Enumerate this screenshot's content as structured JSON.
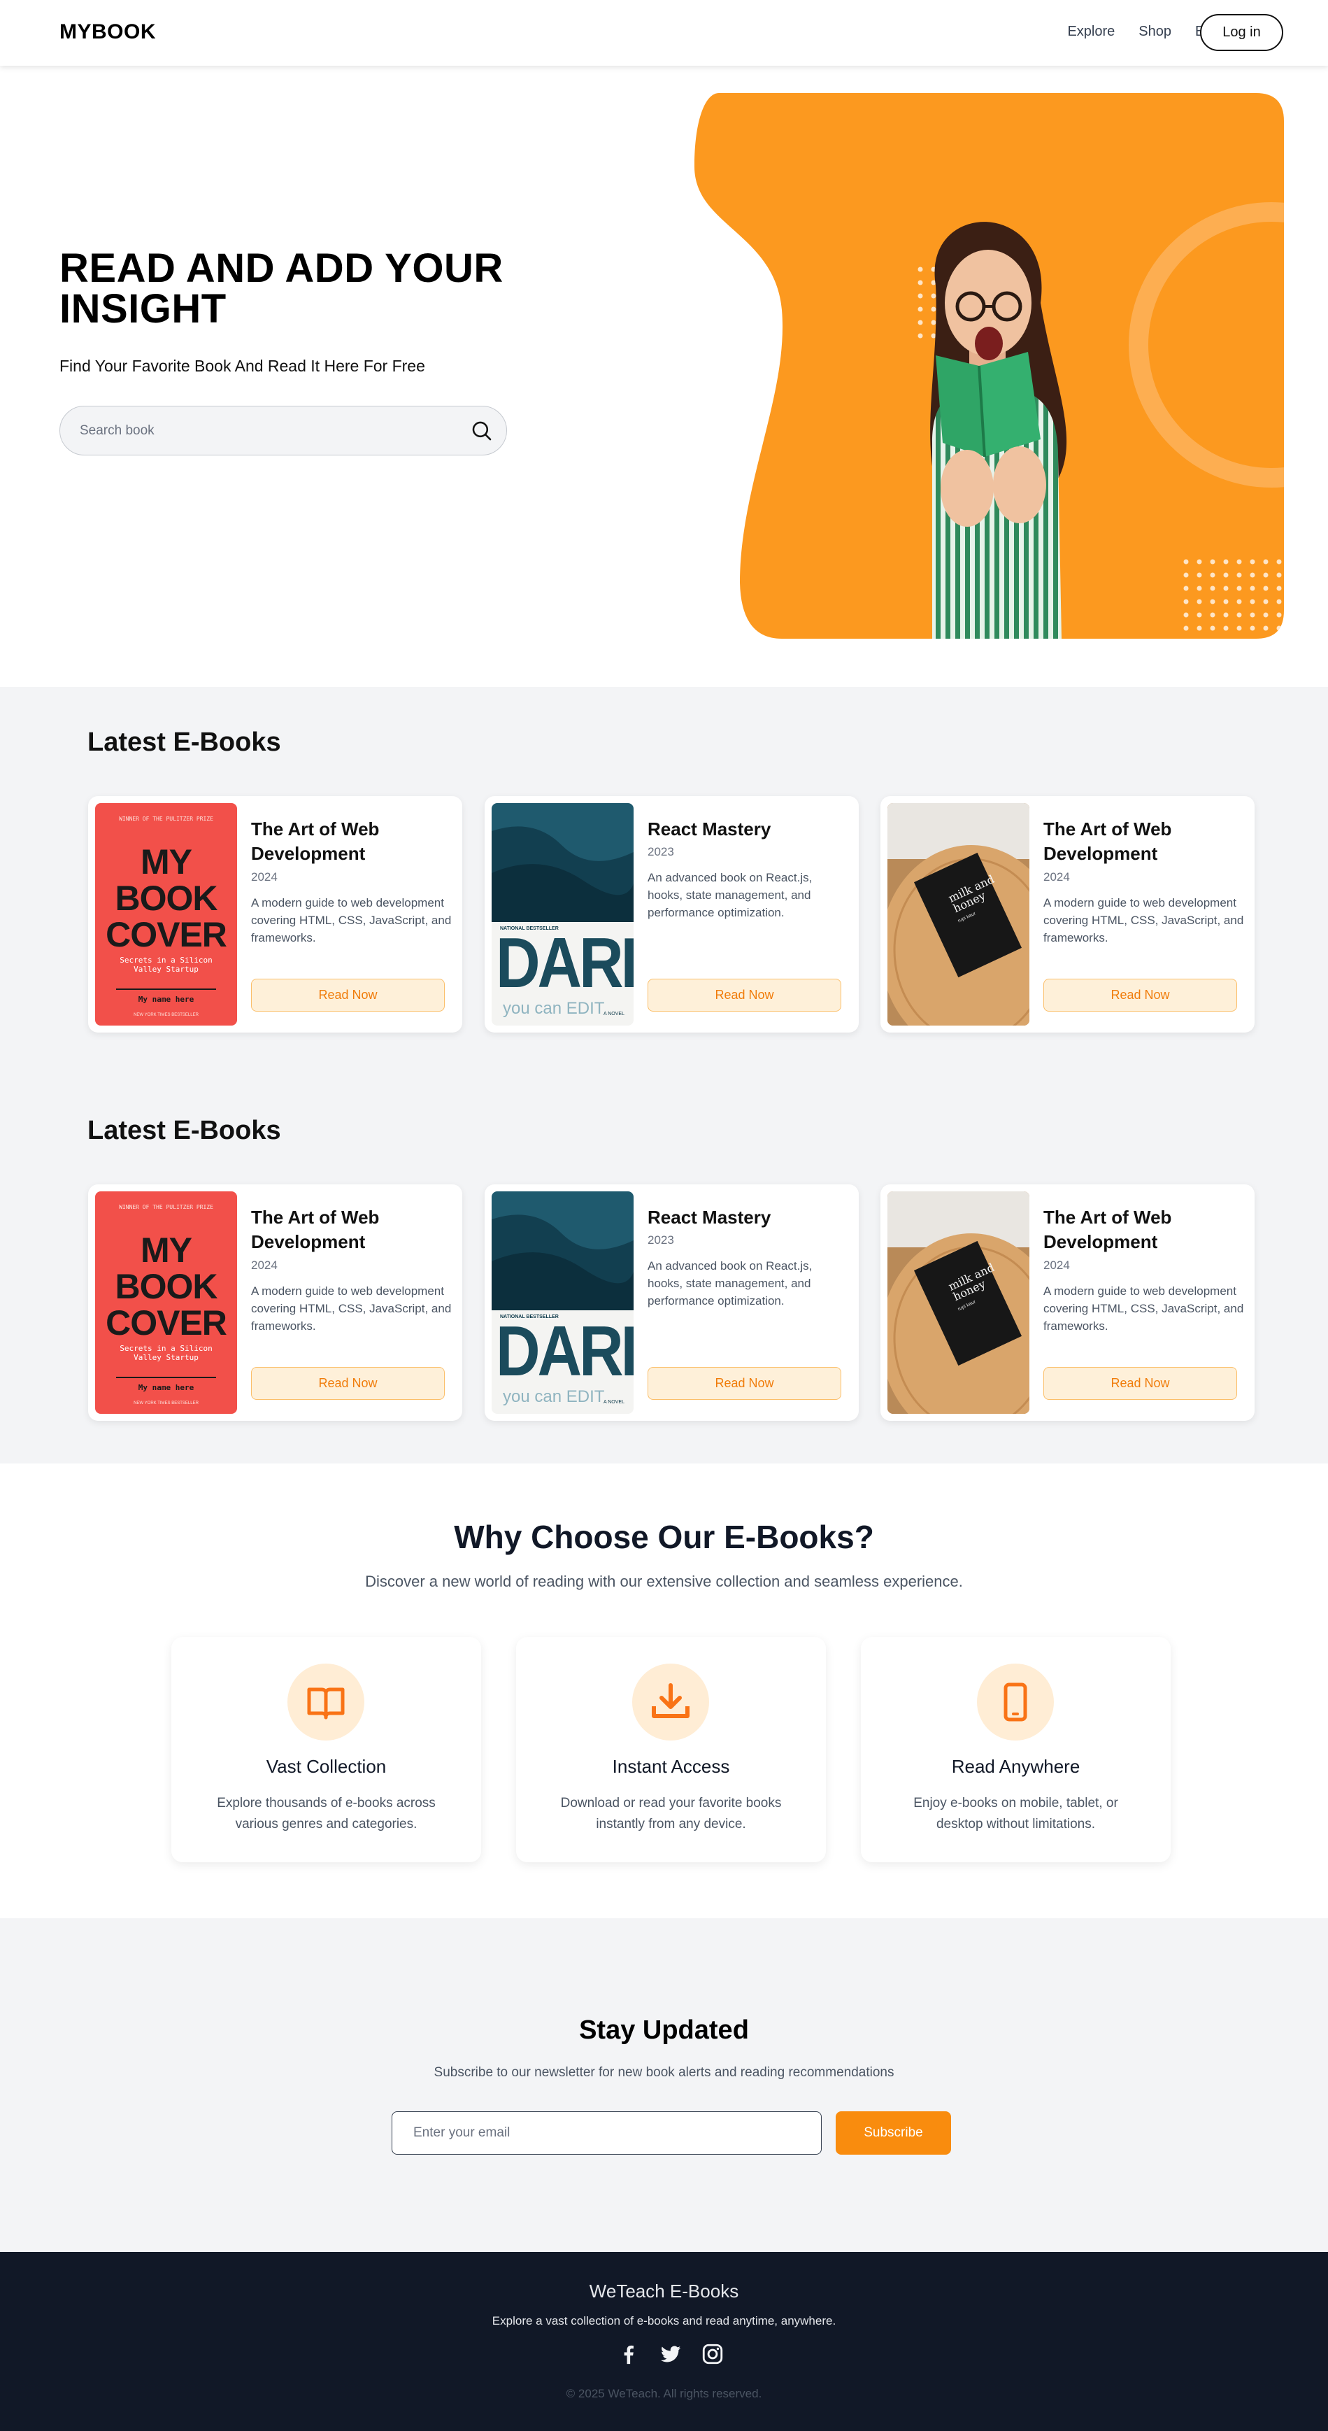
{
  "nav": {
    "logo": "MYBOOK",
    "links": [
      "Explore",
      "Shop",
      "Blog"
    ],
    "login_label": "Log in"
  },
  "hero": {
    "title": "READ AND ADD YOUR INSIGHT",
    "subtitle": "Find Your Favorite Book And Read It Here For Free",
    "search_placeholder": "Search book"
  },
  "sections": [
    {
      "title": "Latest E-Books",
      "books": [
        {
          "title": "The Art of Web Development",
          "year": "2024",
          "description": "A modern guide to web development covering HTML, CSS, JavaScript, and frameworks.",
          "button": "Read Now",
          "cover": {
            "top": "WINNER OF THE PULITZER PRIZE",
            "big": [
              "MY",
              "BOOK",
              "COVER"
            ],
            "tag": "Secrets in a Silicon Valley Startup",
            "name": "My name here",
            "foot": "NEW YORK TIMES BESTSELLER"
          }
        },
        {
          "title": "React Mastery",
          "year": "2023",
          "description": "An advanced book on React.js, hooks, state management, and performance optimization.",
          "button": "Read Now",
          "cover": {
            "small": "NATIONAL BESTSELLER",
            "big": "DARK",
            "sub": "you can EDIT",
            "novel": "A NOVEL"
          }
        },
        {
          "title": "The Art of Web Development",
          "year": "2024",
          "description": "A modern guide to web development covering HTML, CSS, JavaScript, and frameworks.",
          "button": "Read Now",
          "cover": {
            "book_title": "milk and honey",
            "author": "rupi kaur"
          }
        }
      ]
    },
    {
      "title": "Latest E-Books",
      "books": [
        {
          "title": "The Art of Web Development",
          "year": "2024",
          "description": "A modern guide to web development covering HTML, CSS, JavaScript, and frameworks.",
          "button": "Read Now",
          "cover": {
            "top": "WINNER OF THE PULITZER PRIZE",
            "big": [
              "MY",
              "BOOK",
              "COVER"
            ],
            "tag": "Secrets in a Silicon Valley Startup",
            "name": "My name here",
            "foot": "NEW YORK TIMES BESTSELLER"
          }
        },
        {
          "title": "React Mastery",
          "year": "2023",
          "description": "An advanced book on React.js, hooks, state management, and performance optimization.",
          "button": "Read Now",
          "cover": {
            "small": "NATIONAL BESTSELLER",
            "big": "DARK",
            "sub": "you can EDIT",
            "novel": "A NOVEL"
          }
        },
        {
          "title": "The Art of Web Development",
          "year": "2024",
          "description": "A modern guide to web development covering HTML, CSS, JavaScript, and frameworks.",
          "button": "Read Now",
          "cover": {
            "book_title": "milk and honey",
            "author": "rupi kaur"
          }
        }
      ]
    }
  ],
  "why": {
    "title": "Why Choose Our E-Books?",
    "subtitle": "Discover a new world of reading with our extensive collection and seamless experience.",
    "features": [
      {
        "icon": "open-book-icon",
        "title": "Vast Collection",
        "description": "Explore thousands of e-books across various genres and categories."
      },
      {
        "icon": "download-icon",
        "title": "Instant Access",
        "description": "Download or read your favorite books instantly from any device."
      },
      {
        "icon": "mobile-phone-icon",
        "title": "Read Anywhere",
        "description": "Enjoy e-books on mobile, tablet, or desktop without limitations."
      }
    ]
  },
  "newsletter": {
    "title": "Stay Updated",
    "subtitle": "Subscribe to our newsletter for new book alerts and reading recommendations",
    "email_placeholder": "Enter your email",
    "button": "Subscribe"
  },
  "footer": {
    "title": "WeTeach E-Books",
    "subtitle": "Explore a vast collection of e-books and read anytime, anywhere.",
    "social": [
      "facebook-icon",
      "twitter-icon",
      "instagram-icon"
    ],
    "copyright": "© 2025 WeTeach. All rights reserved."
  },
  "colors": {
    "accent": "#f98c0e",
    "hero_blob": "#fc991f",
    "footer_bg": "#111827",
    "section_bg": "#f3f4f6"
  }
}
